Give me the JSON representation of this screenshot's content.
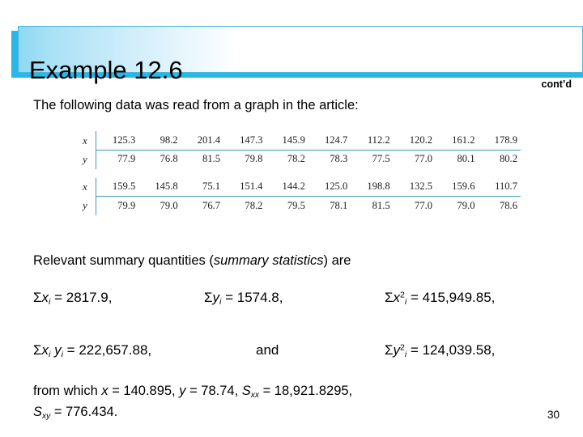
{
  "slide": {
    "title": "Example 12.6",
    "contd_label": "cont’d",
    "page_number": "30",
    "intro_line": "The following data was read from a graph in the article:",
    "accent_color": "#29b6e8",
    "banner_border_color": "#4ab8d8",
    "table_rule_color": "#3e9ab5"
  },
  "data_table": {
    "row_labels": [
      "x",
      "y",
      "x",
      "y"
    ],
    "block1": {
      "x_label": "x",
      "y_label": "y",
      "x": [
        "125.3",
        "98.2",
        "201.4",
        "147.3",
        "145.9",
        "124.7",
        "112.2",
        "120.2",
        "161.2",
        "178.9"
      ],
      "y": [
        "77.9",
        "76.8",
        "81.5",
        "79.8",
        "78.2",
        "78.3",
        "77.5",
        "77.0",
        "80.1",
        "80.2"
      ]
    },
    "block2": {
      "x_label": "x",
      "y_label": "y",
      "x": [
        "159.5",
        "145.8",
        "75.1",
        "151.4",
        "144.2",
        "125.0",
        "198.8",
        "132.5",
        "159.6",
        "110.7"
      ],
      "y": [
        "79.9",
        "79.0",
        "76.7",
        "78.2",
        "79.5",
        "78.1",
        "81.5",
        "77.0",
        "79.0",
        "78.6"
      ]
    }
  },
  "summary": {
    "heading_pre": "Relevant summary quantities (",
    "heading_italic": "summary statistics",
    "heading_post": ") are",
    "sum_x": {
      "sigma": "Σ",
      "var": "x",
      "sub": "i",
      "eq": " = ",
      "value": "2817.9,"
    },
    "sum_y": {
      "sigma": "Σ",
      "var": "y",
      "sub": "i",
      "eq": " = ",
      "value": "1574.8,"
    },
    "sum_x2": {
      "sigma": "Σ",
      "var": "x",
      "sup": "2",
      "sub": "i",
      "eq": " = ",
      "value": "415,949.85,"
    },
    "sum_xy": {
      "sigma": "Σ",
      "var1": "x",
      "sub1": "i",
      "var2": "y",
      "sub2": "i",
      "eq": " = ",
      "value": "222,657.88,"
    },
    "and_label": "and",
    "sum_y2": {
      "sigma": "Σ",
      "var": "y",
      "sup": "2",
      "sub": "i",
      "eq": " = ",
      "value": "124,039.58,"
    }
  },
  "results": {
    "lead_in": "from which ",
    "x_var": "x",
    "x_eq": " = 140.895, ",
    "y_var": "y",
    "y_eq": " = 78.74, ",
    "sxx_var": "S",
    "sxx_sub": "xx",
    "sxx_eq": " = 18,921.8295,",
    "sxy_var": "S",
    "sxy_sub": "xy",
    "sxy_eq": " = 776.434."
  }
}
